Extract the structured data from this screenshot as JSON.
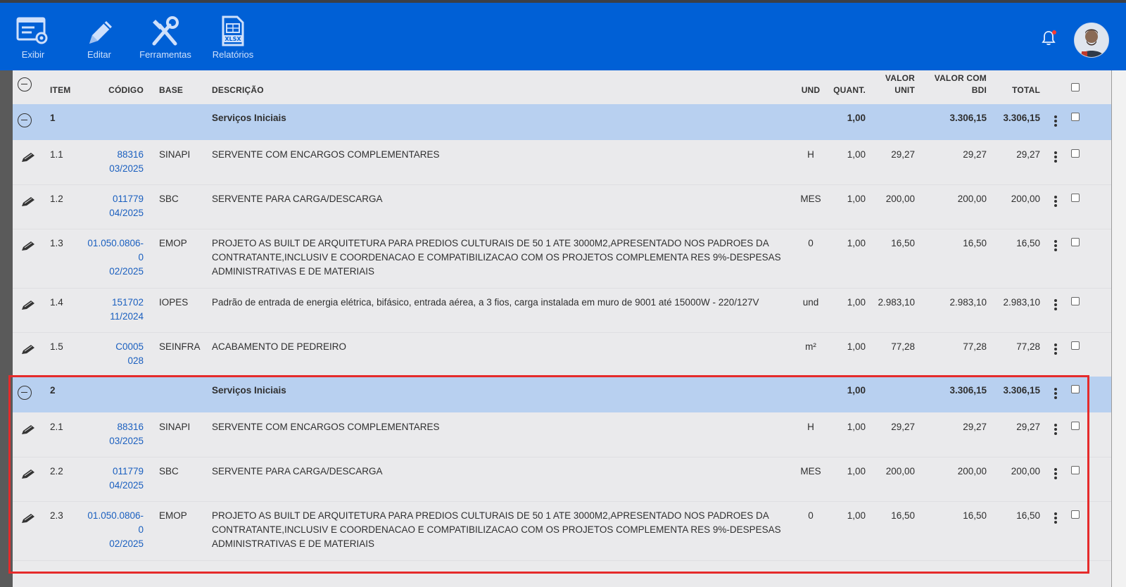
{
  "toolbar": {
    "items": [
      {
        "label": "Exibir",
        "icon": "display-list-icon"
      },
      {
        "label": "Editar",
        "icon": "pencil-icon"
      },
      {
        "label": "Ferramentas",
        "icon": "tools-icon"
      },
      {
        "label": "Relatórios",
        "icon": "xlsx-file-icon",
        "badge": "XLSX"
      }
    ]
  },
  "header": {
    "item": "ITEM",
    "codigo": "CÓDIGO",
    "base": "BASE",
    "descricao": "DESCRIÇÃO",
    "und": "UND",
    "quant": "QUANT.",
    "valor_unit_1": "VALOR",
    "valor_unit_2": "UNIT",
    "valor_bdi_1": "VALOR COM",
    "valor_bdi_2": "BDI",
    "total": "TOTAL"
  },
  "groups": [
    {
      "item": "1",
      "descricao": "Serviços Iniciais",
      "quant": "1,00",
      "valor_bdi": "3.306,15",
      "total": "3.306,15"
    },
    {
      "item": "2",
      "descricao": "Serviços Iniciais",
      "quant": "1,00",
      "valor_bdi": "3.306,15",
      "total": "3.306,15"
    }
  ],
  "rows": [
    {
      "item": "1.1",
      "codigo": [
        "88316",
        "03/2025"
      ],
      "base": "SINAPI",
      "descricao": [
        "SERVENTE COM ENCARGOS COMPLEMENTARES"
      ],
      "und": "H",
      "quant": "1,00",
      "valor_unit": "29,27",
      "valor_bdi": "29,27",
      "total": "29,27"
    },
    {
      "item": "1.2",
      "codigo": [
        "011779",
        "04/2025"
      ],
      "base": "SBC",
      "descricao": [
        "SERVENTE PARA CARGA/DESCARGA"
      ],
      "und": "MES",
      "quant": "1,00",
      "valor_unit": "200,00",
      "valor_bdi": "200,00",
      "total": "200,00"
    },
    {
      "item": "1.3",
      "codigo": [
        "01.050.0806-",
        "0",
        "02/2025"
      ],
      "base": "EMOP",
      "descricao": [
        "PROJETO AS BUILT DE ARQUITETURA PARA PREDIOS CULTURAIS DE 50 1 ATE 3000M2,APRESENTADO NOS PADROES DA",
        "CONTRATANTE,INCLUSIV E COORDENACAO E COMPATIBILIZACAO COM OS PROJETOS COMPLEMENTA RES 9%-DESPESAS",
        "ADMINISTRATIVAS E DE MATERIAIS"
      ],
      "und": "0",
      "quant": "1,00",
      "valor_unit": "16,50",
      "valor_bdi": "16,50",
      "total": "16,50"
    },
    {
      "item": "1.4",
      "codigo": [
        "151702",
        "11/2024"
      ],
      "base": "IOPES",
      "descricao": [
        "Padrão de entrada de energia elétrica, bifásico, entrada aérea, a 3 fios, carga instalada em muro de 9001 até 15000W - 220/127V"
      ],
      "und": "und",
      "quant": "1,00",
      "valor_unit": "2.983,10",
      "valor_bdi": "2.983,10",
      "total": "2.983,10"
    },
    {
      "item": "1.5",
      "codigo": [
        "C0005",
        "028"
      ],
      "base": "SEINFRA",
      "descricao": [
        "ACABAMENTO DE PEDREIRO"
      ],
      "und": "m²",
      "quant": "1,00",
      "valor_unit": "77,28",
      "valor_bdi": "77,28",
      "total": "77,28"
    },
    {
      "item": "2.1",
      "codigo": [
        "88316",
        "03/2025"
      ],
      "base": "SINAPI",
      "descricao": [
        "SERVENTE COM ENCARGOS COMPLEMENTARES"
      ],
      "und": "H",
      "quant": "1,00",
      "valor_unit": "29,27",
      "valor_bdi": "29,27",
      "total": "29,27"
    },
    {
      "item": "2.2",
      "codigo": [
        "011779",
        "04/2025"
      ],
      "base": "SBC",
      "descricao": [
        "SERVENTE PARA CARGA/DESCARGA"
      ],
      "und": "MES",
      "quant": "1,00",
      "valor_unit": "200,00",
      "valor_bdi": "200,00",
      "total": "200,00"
    },
    {
      "item": "2.3",
      "codigo": [
        "01.050.0806-",
        "0",
        "02/2025"
      ],
      "base": "EMOP",
      "descricao": [
        "PROJETO AS BUILT DE ARQUITETURA PARA PREDIOS CULTURAIS DE 50 1 ATE 3000M2,APRESENTADO NOS PADROES DA",
        "CONTRATANTE,INCLUSIV E COORDENACAO E COMPATIBILIZACAO COM OS PROJETOS COMPLEMENTA RES 9%-DESPESAS",
        "ADMINISTRATIVAS E DE MATERIAIS"
      ],
      "und": "0",
      "quant": "1,00",
      "valor_unit": "16,50",
      "valor_bdi": "16,50",
      "total": "16,50"
    }
  ],
  "colors": {
    "toolbar_bg": "#0060d6",
    "group_row_bg": "#b8d0f0",
    "code_link": "#1a5fbf",
    "highlight_border": "#e52b2b"
  }
}
